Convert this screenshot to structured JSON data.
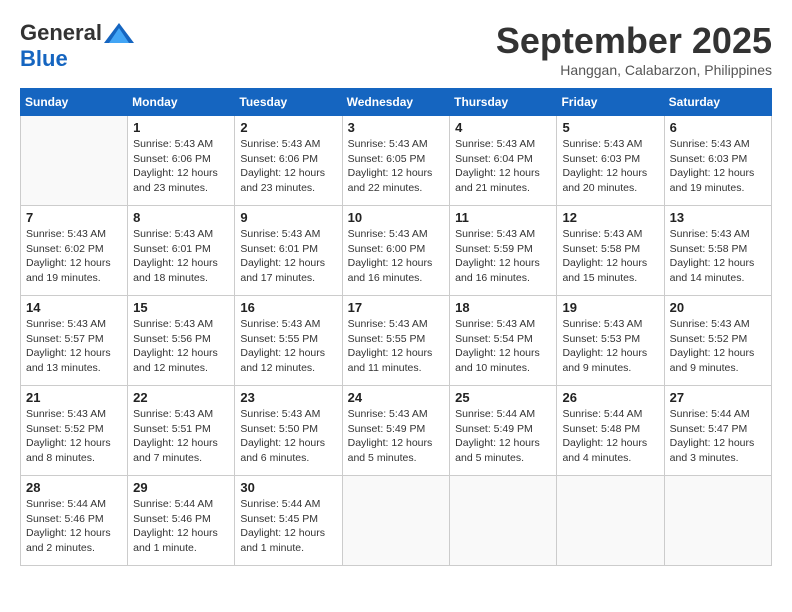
{
  "header": {
    "logo_general": "General",
    "logo_blue": "Blue",
    "month_title": "September 2025",
    "subtitle": "Hanggan, Calabarzon, Philippines"
  },
  "days_of_week": [
    "Sunday",
    "Monday",
    "Tuesday",
    "Wednesday",
    "Thursday",
    "Friday",
    "Saturday"
  ],
  "weeks": [
    [
      {
        "day": "",
        "info": ""
      },
      {
        "day": "1",
        "info": "Sunrise: 5:43 AM\nSunset: 6:06 PM\nDaylight: 12 hours\nand 23 minutes."
      },
      {
        "day": "2",
        "info": "Sunrise: 5:43 AM\nSunset: 6:06 PM\nDaylight: 12 hours\nand 23 minutes."
      },
      {
        "day": "3",
        "info": "Sunrise: 5:43 AM\nSunset: 6:05 PM\nDaylight: 12 hours\nand 22 minutes."
      },
      {
        "day": "4",
        "info": "Sunrise: 5:43 AM\nSunset: 6:04 PM\nDaylight: 12 hours\nand 21 minutes."
      },
      {
        "day": "5",
        "info": "Sunrise: 5:43 AM\nSunset: 6:03 PM\nDaylight: 12 hours\nand 20 minutes."
      },
      {
        "day": "6",
        "info": "Sunrise: 5:43 AM\nSunset: 6:03 PM\nDaylight: 12 hours\nand 19 minutes."
      }
    ],
    [
      {
        "day": "7",
        "info": "Sunrise: 5:43 AM\nSunset: 6:02 PM\nDaylight: 12 hours\nand 19 minutes."
      },
      {
        "day": "8",
        "info": "Sunrise: 5:43 AM\nSunset: 6:01 PM\nDaylight: 12 hours\nand 18 minutes."
      },
      {
        "day": "9",
        "info": "Sunrise: 5:43 AM\nSunset: 6:01 PM\nDaylight: 12 hours\nand 17 minutes."
      },
      {
        "day": "10",
        "info": "Sunrise: 5:43 AM\nSunset: 6:00 PM\nDaylight: 12 hours\nand 16 minutes."
      },
      {
        "day": "11",
        "info": "Sunrise: 5:43 AM\nSunset: 5:59 PM\nDaylight: 12 hours\nand 16 minutes."
      },
      {
        "day": "12",
        "info": "Sunrise: 5:43 AM\nSunset: 5:58 PM\nDaylight: 12 hours\nand 15 minutes."
      },
      {
        "day": "13",
        "info": "Sunrise: 5:43 AM\nSunset: 5:58 PM\nDaylight: 12 hours\nand 14 minutes."
      }
    ],
    [
      {
        "day": "14",
        "info": "Sunrise: 5:43 AM\nSunset: 5:57 PM\nDaylight: 12 hours\nand 13 minutes."
      },
      {
        "day": "15",
        "info": "Sunrise: 5:43 AM\nSunset: 5:56 PM\nDaylight: 12 hours\nand 12 minutes."
      },
      {
        "day": "16",
        "info": "Sunrise: 5:43 AM\nSunset: 5:55 PM\nDaylight: 12 hours\nand 12 minutes."
      },
      {
        "day": "17",
        "info": "Sunrise: 5:43 AM\nSunset: 5:55 PM\nDaylight: 12 hours\nand 11 minutes."
      },
      {
        "day": "18",
        "info": "Sunrise: 5:43 AM\nSunset: 5:54 PM\nDaylight: 12 hours\nand 10 minutes."
      },
      {
        "day": "19",
        "info": "Sunrise: 5:43 AM\nSunset: 5:53 PM\nDaylight: 12 hours\nand 9 minutes."
      },
      {
        "day": "20",
        "info": "Sunrise: 5:43 AM\nSunset: 5:52 PM\nDaylight: 12 hours\nand 9 minutes."
      }
    ],
    [
      {
        "day": "21",
        "info": "Sunrise: 5:43 AM\nSunset: 5:52 PM\nDaylight: 12 hours\nand 8 minutes."
      },
      {
        "day": "22",
        "info": "Sunrise: 5:43 AM\nSunset: 5:51 PM\nDaylight: 12 hours\nand 7 minutes."
      },
      {
        "day": "23",
        "info": "Sunrise: 5:43 AM\nSunset: 5:50 PM\nDaylight: 12 hours\nand 6 minutes."
      },
      {
        "day": "24",
        "info": "Sunrise: 5:43 AM\nSunset: 5:49 PM\nDaylight: 12 hours\nand 5 minutes."
      },
      {
        "day": "25",
        "info": "Sunrise: 5:44 AM\nSunset: 5:49 PM\nDaylight: 12 hours\nand 5 minutes."
      },
      {
        "day": "26",
        "info": "Sunrise: 5:44 AM\nSunset: 5:48 PM\nDaylight: 12 hours\nand 4 minutes."
      },
      {
        "day": "27",
        "info": "Sunrise: 5:44 AM\nSunset: 5:47 PM\nDaylight: 12 hours\nand 3 minutes."
      }
    ],
    [
      {
        "day": "28",
        "info": "Sunrise: 5:44 AM\nSunset: 5:46 PM\nDaylight: 12 hours\nand 2 minutes."
      },
      {
        "day": "29",
        "info": "Sunrise: 5:44 AM\nSunset: 5:46 PM\nDaylight: 12 hours\nand 1 minute."
      },
      {
        "day": "30",
        "info": "Sunrise: 5:44 AM\nSunset: 5:45 PM\nDaylight: 12 hours\nand 1 minute."
      },
      {
        "day": "",
        "info": ""
      },
      {
        "day": "",
        "info": ""
      },
      {
        "day": "",
        "info": ""
      },
      {
        "day": "",
        "info": ""
      }
    ]
  ]
}
